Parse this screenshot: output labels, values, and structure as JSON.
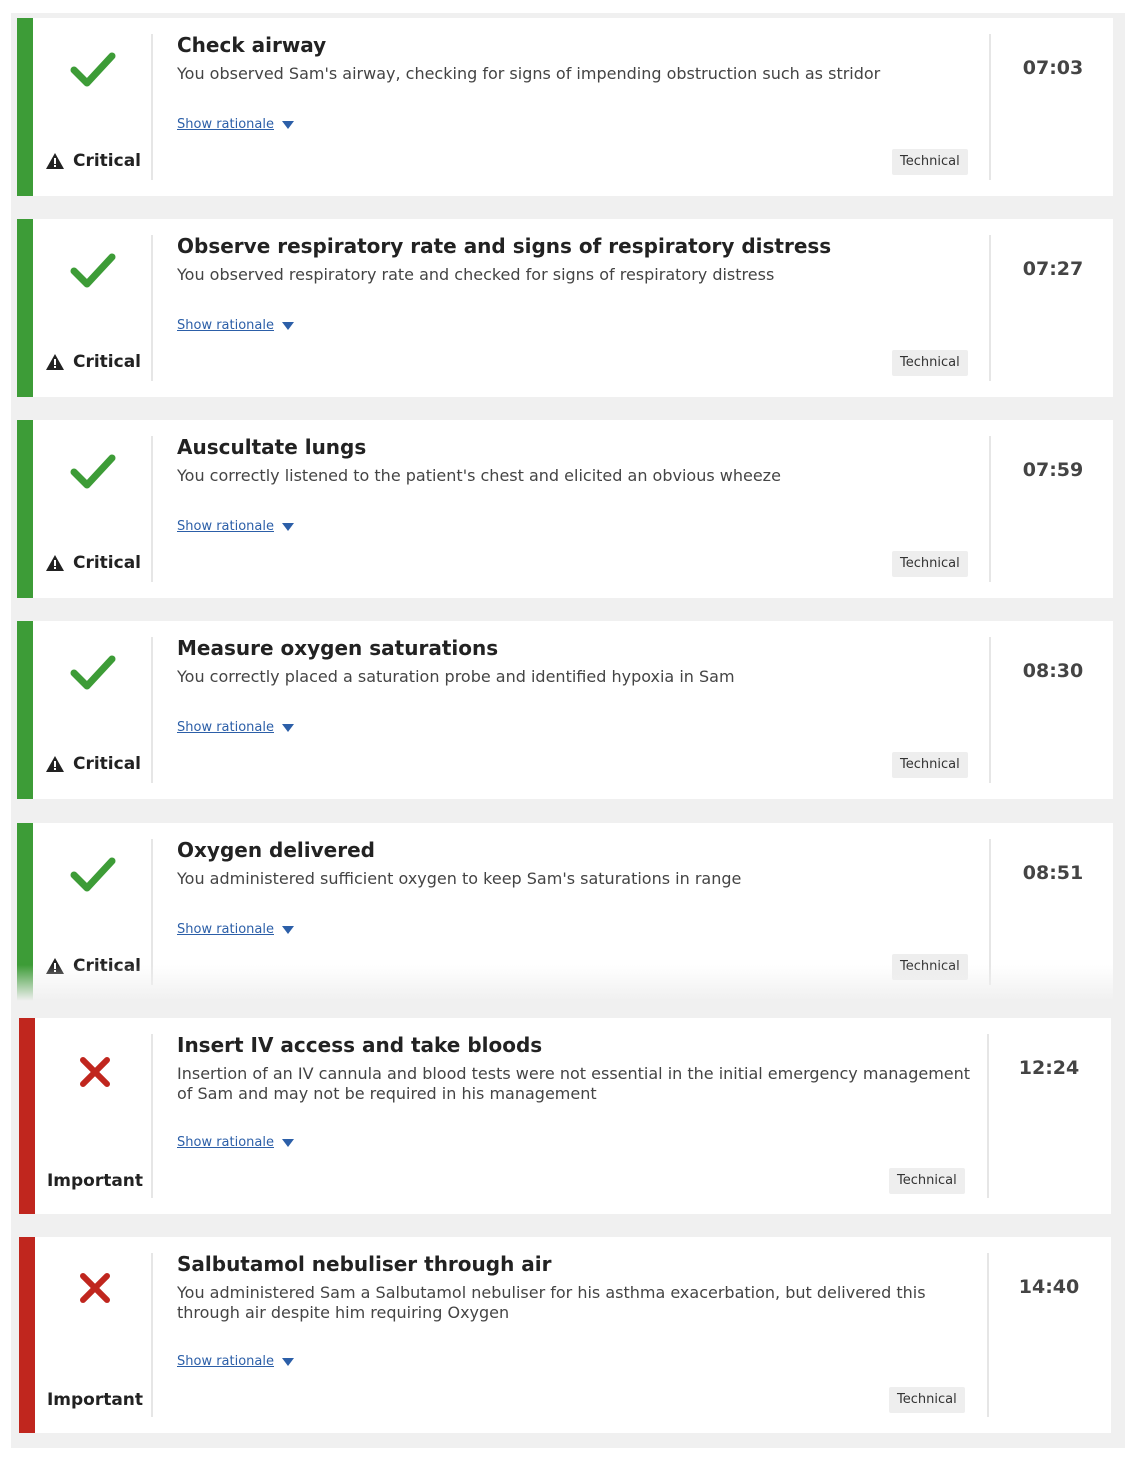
{
  "colors": {
    "pass": "#3d9c37",
    "fail": "#c0261e",
    "link": "#2c5fa8"
  },
  "items": [
    {
      "status": "pass",
      "status_icon": "checkmark-icon",
      "level": "Critical",
      "level_icon": "warning-icon",
      "title": "Check airway",
      "description": "You observed Sam's airway, checking for signs of impending obstruction such as stridor",
      "rationale_label": "Show rationale",
      "tag": "Technical",
      "time": "07:03"
    },
    {
      "status": "pass",
      "status_icon": "checkmark-icon",
      "level": "Critical",
      "level_icon": "warning-icon",
      "title": "Observe respiratory rate and signs of respiratory distress",
      "description": "You observed respiratory rate and checked for signs of respiratory distress",
      "rationale_label": "Show rationale",
      "tag": "Technical",
      "time": "07:27"
    },
    {
      "status": "pass",
      "status_icon": "checkmark-icon",
      "level": "Critical",
      "level_icon": "warning-icon",
      "title": "Auscultate lungs",
      "description": "You correctly listened to the patient's chest and elicited an obvious wheeze",
      "rationale_label": "Show rationale",
      "tag": "Technical",
      "time": "07:59"
    },
    {
      "status": "pass",
      "status_icon": "checkmark-icon",
      "level": "Critical",
      "level_icon": "warning-icon",
      "title": "Measure oxygen saturations",
      "description": "You correctly placed a saturation probe and identified hypoxia in Sam",
      "rationale_label": "Show rationale",
      "tag": "Technical",
      "time": "08:30"
    },
    {
      "status": "pass",
      "status_icon": "checkmark-icon",
      "level": "Critical",
      "level_icon": "warning-icon",
      "title": "Oxygen delivered",
      "description": "You administered sufficient oxygen to keep Sam's saturations in range",
      "rationale_label": "Show rationale",
      "tag": "Technical",
      "time": "08:51"
    },
    {
      "status": "fail",
      "status_icon": "cross-icon",
      "level": "Important",
      "title": "Insert IV access and take bloods",
      "description": "Insertion of an IV cannula and blood tests were not essential in the initial emergency management of Sam and may not be required in his management",
      "rationale_label": "Show rationale",
      "tag": "Technical",
      "time": "12:24"
    },
    {
      "status": "fail",
      "status_icon": "cross-icon",
      "level": "Important",
      "title": "Salbutamol nebuliser through air",
      "description": "You administered Sam a Salbutamol nebuliser for his asthma exacerbation, but delivered this through air despite him requiring Oxygen",
      "rationale_label": "Show rationale",
      "tag": "Technical",
      "time": "14:40"
    }
  ]
}
